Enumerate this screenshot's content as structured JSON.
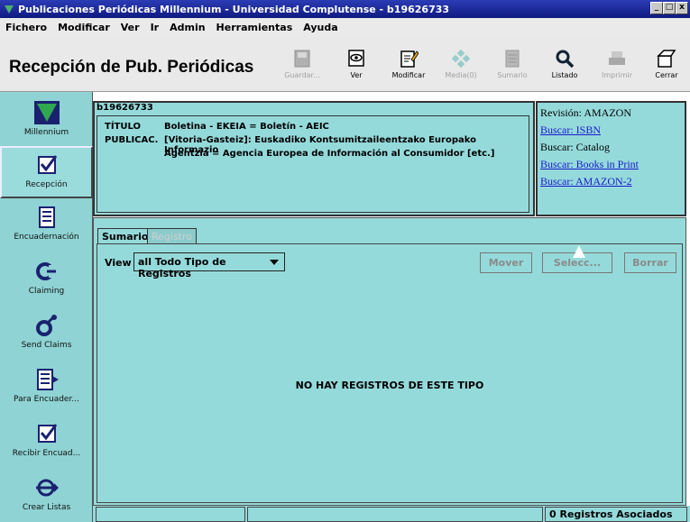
{
  "window": {
    "title": "Publicaciones Periódicas Millennium - Universidad Complutense - b19626733",
    "controls": [
      "_",
      "□",
      "x"
    ]
  },
  "menu": [
    "Fichero",
    "Modificar",
    "Ver",
    "Ir",
    "Admin",
    "Herramientas",
    "Ayuda"
  ],
  "header": {
    "title": "Recepción de Pub. Periódicas",
    "tools": [
      {
        "label": "Guardar...",
        "icon": "save-icon",
        "enabled": false
      },
      {
        "label": "Ver",
        "icon": "view-icon",
        "enabled": true
      },
      {
        "label": "Modificar",
        "icon": "edit-icon",
        "enabled": true
      },
      {
        "label": "Media(0)",
        "icon": "media-icon",
        "enabled": false
      },
      {
        "label": "Sumario",
        "icon": "summary-icon",
        "enabled": false
      },
      {
        "label": "Listado",
        "icon": "search-icon",
        "enabled": true
      },
      {
        "label": "Imprimir",
        "icon": "print-icon",
        "enabled": false
      },
      {
        "label": "Cerrar",
        "icon": "close-folder-icon",
        "enabled": true
      }
    ]
  },
  "nav": [
    {
      "label": "Millennium",
      "icon": "millennium-logo-icon"
    },
    {
      "label": "Recepción",
      "icon": "checkbox-icon"
    },
    {
      "label": "Encuadernación",
      "icon": "binding-icon"
    },
    {
      "label": "Claiming",
      "icon": "claiming-icon"
    },
    {
      "label": "Send Claims",
      "icon": "send-claims-icon"
    },
    {
      "label": "Para Encuader...",
      "icon": "to-bind-icon"
    },
    {
      "label": "Recibir Encuad...",
      "icon": "receive-binding-icon"
    },
    {
      "label": "Crear Listas",
      "icon": "create-lists-icon"
    }
  ],
  "record": {
    "id": "b19626733",
    "titulo_label": "TÍTULO",
    "titulo_value": "Boletina - EKEIA = Boletín - AEIC",
    "publicac_label": "PUBLICAC.",
    "publicac_value1": "[Vitoria-Gasteiz]: Euskadiko Kontsumitzaileentzako Europako Informazio",
    "publicac_value2": "Agentzia = Agencia Europea de Información al Consumidor [etc.]"
  },
  "links": [
    {
      "text": "Revisión: AMAZON",
      "link": false
    },
    {
      "text": "Buscar: ISBN",
      "link": true
    },
    {
      "text": "Buscar: Catalog",
      "link": false
    },
    {
      "text": "Buscar: Books in Print",
      "link": true
    },
    {
      "text": "Buscar: AMAZON-2",
      "link": true
    }
  ],
  "tabs": {
    "active": "Sumario",
    "inactive": "Registro"
  },
  "panel": {
    "view_label": "View",
    "view_value": "all Todo Tipo de Registros",
    "buttons": [
      "Mover",
      "Selecc...",
      "Borrar"
    ],
    "empty_message": "NO HAY REGISTROS DE ESTE TIPO"
  },
  "status": {
    "assoc": "0 Registros Asociados"
  },
  "colors": {
    "panel": "#95dadb",
    "nav": "#8fd3d4",
    "titlebar": "#1b2a9c",
    "link": "#1a1acc"
  }
}
